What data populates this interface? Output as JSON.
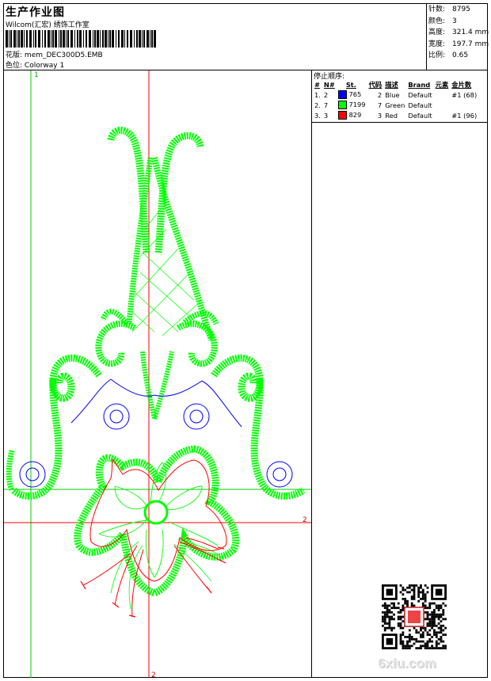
{
  "header": {
    "title": "生产作业图",
    "subtitle": "Wilcom(汇宏) 绣饰工作室",
    "design_label": "花版:",
    "design_value": "mem_DEC300D5.EMB",
    "colorway_label": "色位:",
    "colorway_value": "Colorway 1"
  },
  "stats": [
    {
      "label": "针数:",
      "value": "8795"
    },
    {
      "label": "颜色:",
      "value": "3"
    },
    {
      "label": "高度:",
      "value": "321.4 mm"
    },
    {
      "label": "宽度:",
      "value": "197.7 mm"
    },
    {
      "label": "比例:",
      "value": "0.65"
    }
  ],
  "stop_sequence": {
    "title": "停止顺序:",
    "columns": [
      "#",
      "N#",
      "St.",
      "代码",
      "描述",
      "Brand",
      "元素",
      "金片数"
    ],
    "rows": [
      {
        "idx": "1.",
        "n": "2",
        "color": "#0000ff",
        "st": "765",
        "code": "2",
        "desc": "Blue",
        "brand": "Default",
        "element": "",
        "sequins": "#1 (68)"
      },
      {
        "idx": "2.",
        "n": "7",
        "color": "#00ff00",
        "st": "7199",
        "code": "7",
        "desc": "Green",
        "brand": "Default",
        "element": "",
        "sequins": ""
      },
      {
        "idx": "3.",
        "n": "3",
        "color": "#ff0000",
        "st": "829",
        "code": "3",
        "desc": "Red",
        "brand": "Default",
        "element": "",
        "sequins": "#1 (96)"
      }
    ]
  },
  "guides": {
    "v1_label": "1",
    "h2_label": "2",
    "v2_label": "2"
  },
  "watermark": "6xiu.com",
  "colors": {
    "blue": "#0000ff",
    "green": "#00ff00",
    "red": "#ff0000",
    "guide_red": "#ff0000",
    "guide_green": "#00cc00"
  }
}
